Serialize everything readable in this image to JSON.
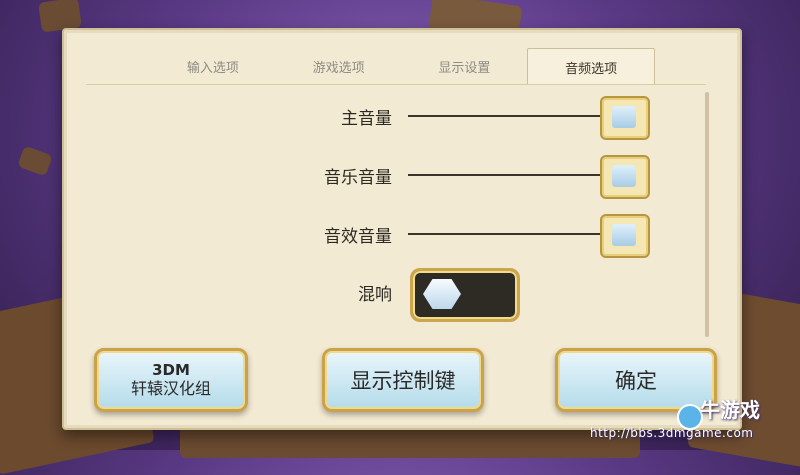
{
  "tabs": [
    {
      "label": "输入选项",
      "active": false
    },
    {
      "label": "游戏选项",
      "active": false
    },
    {
      "label": "显示设置",
      "active": false
    },
    {
      "label": "音频选项",
      "active": true
    }
  ],
  "audio": {
    "master_volume": {
      "label": "主音量",
      "level": 1.0
    },
    "music_volume": {
      "label": "音乐音量",
      "level": 1.0
    },
    "sfx_volume": {
      "label": "音效音量",
      "level": 1.0
    },
    "reverb": {
      "label": "混响",
      "enabled": false
    }
  },
  "buttons": {
    "credit_line1": "3DM",
    "credit_line2": "轩辕汉化组",
    "show_controls": "显示控制键",
    "confirm": "确定"
  },
  "watermark": {
    "logo": "牛游戏",
    "url": "http://bbs.3dmgame.com"
  }
}
